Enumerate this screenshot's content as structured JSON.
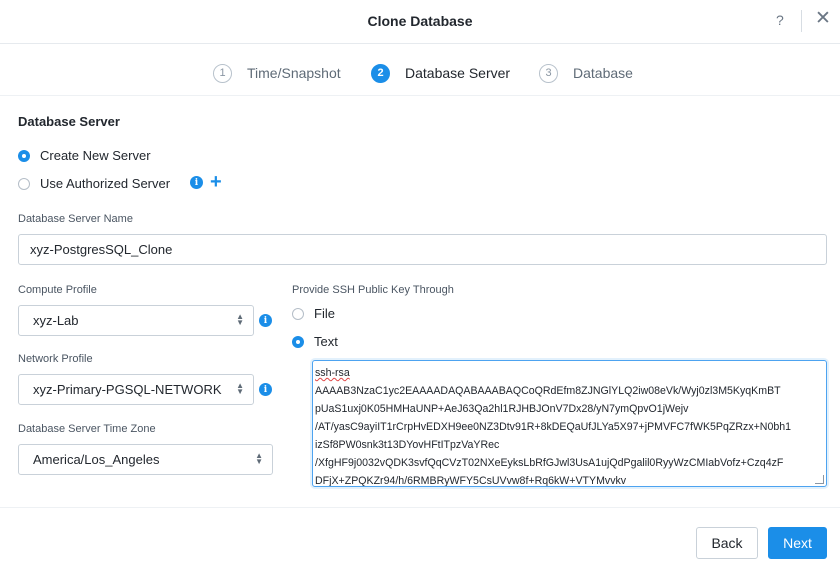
{
  "header": {
    "title": "Clone Database",
    "help_label": "?",
    "close_label": "✕"
  },
  "steps": [
    {
      "number": "1",
      "label": "Time/Snapshot",
      "active": false
    },
    {
      "number": "2",
      "label": "Database Server",
      "active": true
    },
    {
      "number": "3",
      "label": "Database",
      "active": false
    }
  ],
  "server_section": {
    "title": "Database Server",
    "options": [
      {
        "label": "Create New Server",
        "checked": true
      },
      {
        "label": "Use Authorized Server",
        "checked": false
      }
    ],
    "info_icon": "info-icon",
    "add_icon": "plus-icon",
    "add_label": "+"
  },
  "server_name": {
    "label": "Database Server Name",
    "value": "xyz-PostgresSQL_Clone"
  },
  "compute_profile": {
    "label": "Compute Profile",
    "value": "xyz-Lab"
  },
  "network_profile": {
    "label": "Network Profile",
    "value": "xyz-Primary-PGSQL-NETWORK"
  },
  "timezone": {
    "label": "Database Server Time Zone",
    "value": "America/Los_Angeles"
  },
  "ssh": {
    "label": "Provide SSH Public Key Through",
    "options": [
      {
        "label": "File",
        "checked": false
      },
      {
        "label": "Text",
        "checked": true
      }
    ],
    "key_lines": [
      "ssh-rsa",
      "AAAAB3NzaC1yc2EAAAADAQABAAABAQCoQRdEfm8ZJNGlYLQ2iw08eVk/Wyj0zl3M5KyqKmBT",
      "pUaS1uxj0K05HMHaUNP+AeJ63Qa2hl1RJHBJOnV7Dx28/yN7ymQpvO1jWejv",
      "/AT/yasC9ayiIT1rCrpHvEDXH9ee0NZ3Dtv91R+8kDEQaUfJLYa5X97+jPMVFC7fWK5PqZRzx+N0bh1",
      "izSf8PW0snk3t13DYovHFtITpzVaYRec",
      "/XfgHF9j0032vQDK3svfQqCVzT02NXeEyksLbRfGJwl3UsA1ujQdPgalil0RyyWzCMIabVofz+Czq4zF",
      "DFjX+ZPQKZr94/h/6RMBRyWFY5CsUVvw8f+Rq6kW+VTYMvvkv"
    ]
  },
  "footer": {
    "back_label": "Back",
    "next_label": "Next"
  },
  "colors": {
    "accent": "#1b8ee8",
    "text": "#22272e",
    "border": "#c9d1d9"
  }
}
